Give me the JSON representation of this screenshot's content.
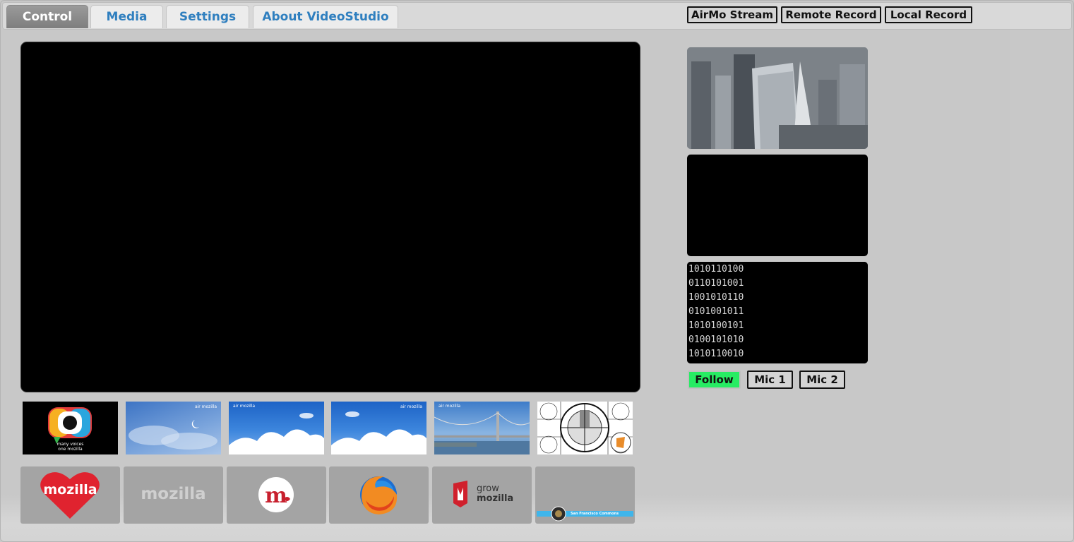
{
  "tabs": [
    {
      "label": "Control",
      "active": true
    },
    {
      "label": "Media",
      "active": false
    },
    {
      "label": "Settings",
      "active": false
    },
    {
      "label": "About VideoStudio",
      "active": false
    }
  ],
  "record_buttons": {
    "stream": "AirMo Stream",
    "remote": "Remote Record",
    "local": "Local Record"
  },
  "thumbs": {
    "many_voices_1": "many voices",
    "many_voices_2": "one mozilla",
    "air_mozilla": "air mozilla"
  },
  "tiles": {
    "mozilla_heart": "mozilla",
    "mozilla_word": "mozilla",
    "grow_1": "grow",
    "grow_2": "mozilla",
    "commons": "San Francisco Commons"
  },
  "audio": {
    "follow": "Follow",
    "mic1": "Mic 1",
    "mic2": "Mic 2"
  },
  "colors": {
    "follow_active": "#27ec63",
    "tab_link": "#2f7fbf"
  }
}
